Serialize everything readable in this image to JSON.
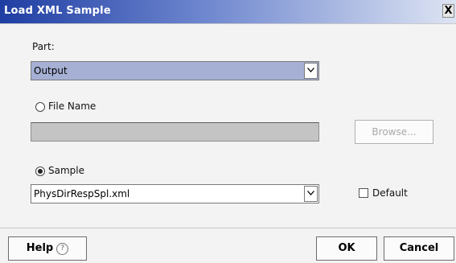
{
  "window": {
    "title": "Load XML Sample",
    "close_glyph": "X"
  },
  "part": {
    "label": "Part:",
    "selected": "Output"
  },
  "file_name": {
    "label": "File Name",
    "selected": false,
    "value": ""
  },
  "browse_label": "Browse...",
  "sample": {
    "label": "Sample",
    "selected": true,
    "value": "PhysDirRespSpl.xml"
  },
  "default_checkbox": {
    "label": "Default",
    "checked": false
  },
  "footer": {
    "help_label": "Help",
    "help_icon": "?",
    "ok_label": "OK",
    "cancel_label": "Cancel"
  },
  "colors": {
    "part_select_bg": "#a6b0d4",
    "title_gradient_start": "#1f3ea3",
    "disabled_field": "#c4c4c4"
  }
}
